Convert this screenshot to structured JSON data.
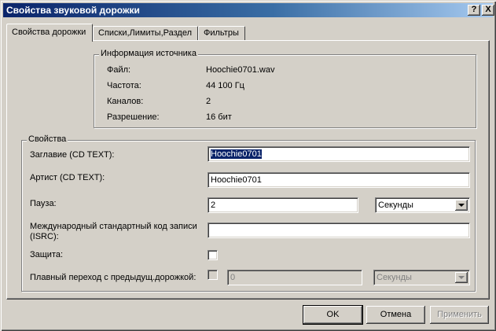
{
  "window": {
    "title": "Свойства звуковой дорожки",
    "help_label": "?",
    "close_label": "X"
  },
  "tabs": [
    {
      "label": "Свойства дорожки"
    },
    {
      "label": "Списки,Лимиты,Раздел"
    },
    {
      "label": "Фильтры"
    }
  ],
  "source": {
    "title": "Информация источника",
    "rows": [
      {
        "label": "Файл:",
        "value": "Hoochie0701.wav"
      },
      {
        "label": "Частота:",
        "value": "44 100 Гц"
      },
      {
        "label": "Каналов:",
        "value": "2"
      },
      {
        "label": "Разрешение:",
        "value": "16 бит"
      }
    ]
  },
  "props": {
    "title": "Свойства",
    "title_label": "Заглавие (CD TEXT):",
    "title_value": "Hoochie0701",
    "artist_label": "Артист (CD TEXT):",
    "artist_value": "Hoochie0701",
    "pause_label": "Пауза:",
    "pause_value": "2",
    "pause_unit": "Секунды",
    "isrc_label": "Международный стандартный код записи (ISRC):",
    "isrc_value": "",
    "protect_label": "Защита:",
    "protect_checked": false,
    "crossfade_label": "Плавный переход с предыдущ.дорожкой:",
    "crossfade_checked": false,
    "crossfade_value": "0",
    "crossfade_unit": "Секунды"
  },
  "buttons": {
    "ok": "OK",
    "cancel": "Отмена",
    "apply": "Применить"
  }
}
